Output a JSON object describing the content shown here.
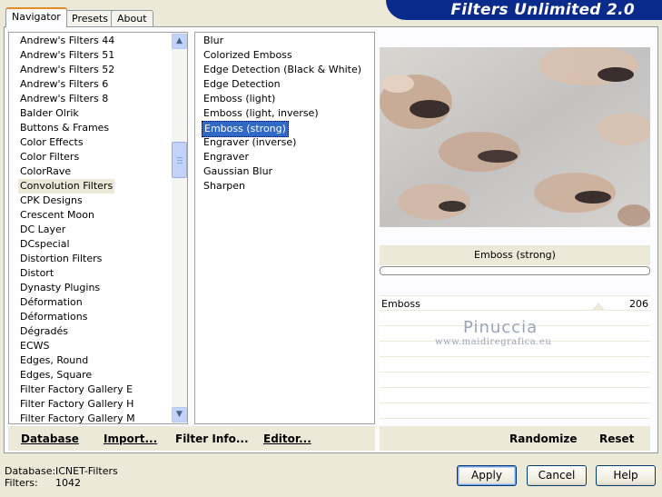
{
  "app": {
    "title": "Filters Unlimited 2.0"
  },
  "tabs": [
    {
      "label": "Navigator",
      "active": true
    },
    {
      "label": "Presets",
      "active": false
    },
    {
      "label": "About",
      "active": false
    }
  ],
  "categories": [
    "Andrew's Filters 44",
    "Andrew's Filters 51",
    "Andrew's Filters 52",
    "Andrew's Filters 6",
    "Andrew's Filters 8",
    "Balder Olrik",
    "Buttons & Frames",
    "Color Effects",
    "Color Filters",
    "ColorRave",
    "Convolution Filters",
    "CPK Designs",
    "Crescent Moon",
    "DC Layer",
    "DCspecial",
    "Distortion Filters",
    "Distort",
    "Dynasty Plugins",
    "Déformation",
    "Déformations",
    "Dégradés",
    "ECWS",
    "Edges, Round",
    "Edges, Square",
    "Filter Factory Gallery E",
    "Filter Factory Gallery H",
    "Filter Factory Gallery M"
  ],
  "selected_category": "Convolution Filters",
  "filters": [
    "Blur",
    "Colorized Emboss",
    "Edge Detection (Black & White)",
    "Edge Detection",
    "Emboss (light)",
    "Emboss (light, inverse)",
    "Emboss (strong)",
    "Engraver (inverse)",
    "Engraver",
    "Gaussian Blur",
    "Sharpen"
  ],
  "selected_filter": "Emboss (strong)",
  "preview": {
    "filter_name": "Emboss (strong)"
  },
  "parameters": [
    {
      "label": "Emboss",
      "value": "206"
    }
  ],
  "watermark": {
    "line1": "Pinuccia",
    "line2": "www.maidiregrafica.eu"
  },
  "toolbar": {
    "database": "Database",
    "import": "Import...",
    "filter_info": "Filter Info...",
    "editor": "Editor...",
    "randomize": "Randomize",
    "reset": "Reset"
  },
  "footer": {
    "database_label": "Database:",
    "database_value": "ICNET-Filters",
    "filters_label": "Filters:",
    "filters_value": "1042"
  },
  "dialog_buttons": {
    "apply": "Apply",
    "cancel": "Cancel",
    "help": "Help"
  },
  "colors": {
    "banner": "#0a2a8c",
    "selection": "#316ac5",
    "window_bg": "#ece9d8"
  }
}
